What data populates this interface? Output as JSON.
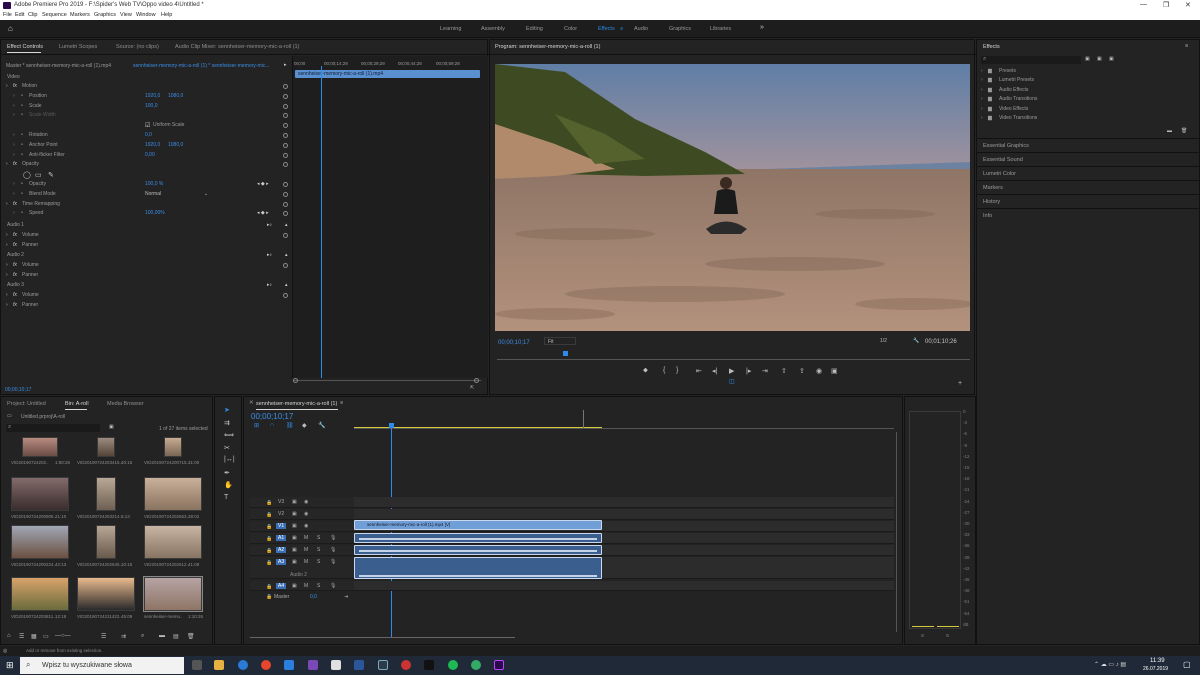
{
  "window": {
    "title": "Adobe Premiere Pro 2019 - F:\\Spider's Web TV\\Oppo video 4\\Untitled *"
  },
  "menu": [
    "File",
    "Edit",
    "Clip",
    "Sequence",
    "Markers",
    "Graphics",
    "View",
    "Window",
    "Help"
  ],
  "workspaces": [
    {
      "label": "Learning"
    },
    {
      "label": "Assembly"
    },
    {
      "label": "Editing"
    },
    {
      "label": "Color"
    },
    {
      "label": "Effects",
      "active": true
    },
    {
      "label": "Audio"
    },
    {
      "label": "Graphics"
    },
    {
      "label": "Libraries"
    }
  ],
  "source_panel": {
    "tabs": [
      "Effect Controls",
      "Lumetri Scopes",
      "Source: (no clips)",
      "Audio Clip Mixer: sennheiser-memory-mic-a-roll (1)"
    ],
    "master_label": "Master * sennheiser-memory-mic-a-roll (1).mp4",
    "clip_label": "sennheiser-memory-mic-a-roll (1) * sennheiser-memory-mic...",
    "ruler": [
      "00;00",
      "00;00;14;29",
      "00;00;29;29",
      "00;00;44;28",
      "00;00;59;28"
    ],
    "clip_name": "sennheiser-memory-mic-a-roll (1).mp4",
    "section_video": "Video",
    "rows": [
      {
        "label": "Motion",
        "indent": 1,
        "fx": true
      },
      {
        "label": "Position",
        "indent": 2,
        "v1": "1920,0",
        "v2": "1080,0"
      },
      {
        "label": "Scale",
        "indent": 2,
        "v1": "100,0"
      },
      {
        "label": "Scale Width",
        "indent": 2,
        "dim": true
      },
      {
        "label": "Uniform Scale",
        "indent": 3,
        "check": true
      },
      {
        "label": "Rotation",
        "indent": 2,
        "v1": "0,0"
      },
      {
        "label": "Anchor Point",
        "indent": 2,
        "v1": "1920,0",
        "v2": "1080,0"
      },
      {
        "label": "Anti-flicker Filter",
        "indent": 2,
        "v1": "0,00"
      },
      {
        "label": "Opacity",
        "indent": 1,
        "fx": true
      },
      {
        "label": "",
        "indent": 2,
        "shapes": true
      },
      {
        "label": "Opacity",
        "indent": 2,
        "v1": "100,0 %"
      },
      {
        "label": "Blend Mode",
        "indent": 2,
        "v1": "Normal"
      },
      {
        "label": "Time Remapping",
        "indent": 1,
        "fx": true
      },
      {
        "label": "Speed",
        "indent": 2,
        "v1": "100,00%"
      }
    ],
    "audio_sections": [
      {
        "title": "Audio 1",
        "items": [
          "Volume",
          "Panner"
        ]
      },
      {
        "title": "Audio 2",
        "items": [
          "Volume",
          "Panner"
        ]
      },
      {
        "title": "Audio 3",
        "items": [
          "Volume",
          "Panner"
        ]
      }
    ],
    "timecode": "00;00;10;17"
  },
  "program": {
    "title": "Program: sennheiser-memory-mic-a-roll (1)",
    "timecode": "00;00;10;17",
    "fit": "Fit",
    "ratio": "1/2",
    "duration": "00;01;10;26"
  },
  "effects_panel": {
    "title": "Effects",
    "folders": [
      "Presets",
      "Lumetri Presets",
      "Audio Effects",
      "Audio Transitions",
      "Video Effects",
      "Video Transitions"
    ],
    "sections": [
      "Essential Graphics",
      "Essential Sound",
      "Lumetri Color",
      "Markers",
      "History",
      "Info"
    ]
  },
  "project_panel": {
    "tabs": [
      "Project: Untitled",
      "Bin: A-roll",
      "Media Browser"
    ],
    "path": "Untitled.prproj\\A-roll",
    "selected": "1 of 27 items selected",
    "items": [
      {
        "name": "VID20190724202..",
        "dur": "1:50:26"
      },
      {
        "name": "VID20190724203415..",
        "dur": "40:15"
      },
      {
        "name": "VID20190724200715..",
        "dur": "31:00"
      },
      {
        "name": "VID20190724200906..",
        "dur": "21:10"
      },
      {
        "name": "VID20190724203214..",
        "dur": "5:13"
      },
      {
        "name": "VID20190724202653..",
        "dur": "39:02"
      },
      {
        "name": "VID20190724200224..",
        "dur": "42:13"
      },
      {
        "name": "VID20190724202645..",
        "dur": "10:15"
      },
      {
        "name": "VID20190724202612..",
        "dur": "41:09"
      },
      {
        "name": "VID20190724203811..",
        "dur": "12:19"
      },
      {
        "name": "VID20190724211422..",
        "dur": "45:09"
      },
      {
        "name": "sennheiser-memo..",
        "dur": "1:10:26"
      }
    ]
  },
  "timeline": {
    "tab": "sennheiser-memory-mic-a-roll (1)",
    "timecode": "00;00;10;17",
    "tracks": [
      "V3",
      "V2",
      "V1",
      "A1",
      "A2",
      "A3",
      "A4"
    ],
    "audio2_label": "Audio 2",
    "master_label": "Master",
    "master_value": "0,0",
    "clip_label": "sennheiser-memory-mic-a-roll (1).mp4 [V]"
  },
  "meter": {
    "ticks": [
      "0",
      "-3",
      "-6",
      "-9",
      "-12",
      "-15",
      "-18",
      "-21",
      "-24",
      "-27",
      "-30",
      "-33",
      "-36",
      "-39",
      "-42",
      "-45",
      "-48",
      "-51",
      "-54",
      "dB"
    ],
    "s1": "S",
    "s2": "S"
  },
  "status": "Add or remove from existing selection.",
  "taskbar": {
    "search_placeholder": "Wpisz tu wyszukiwane słowa",
    "time": "11:39",
    "date": "26.07.2019"
  },
  "colors": {
    "accent": "#2d8ceb",
    "clip_video": "#5a8fd0",
    "clip_audio": "#3a5f8f",
    "playhead": "#2d8ceb"
  }
}
